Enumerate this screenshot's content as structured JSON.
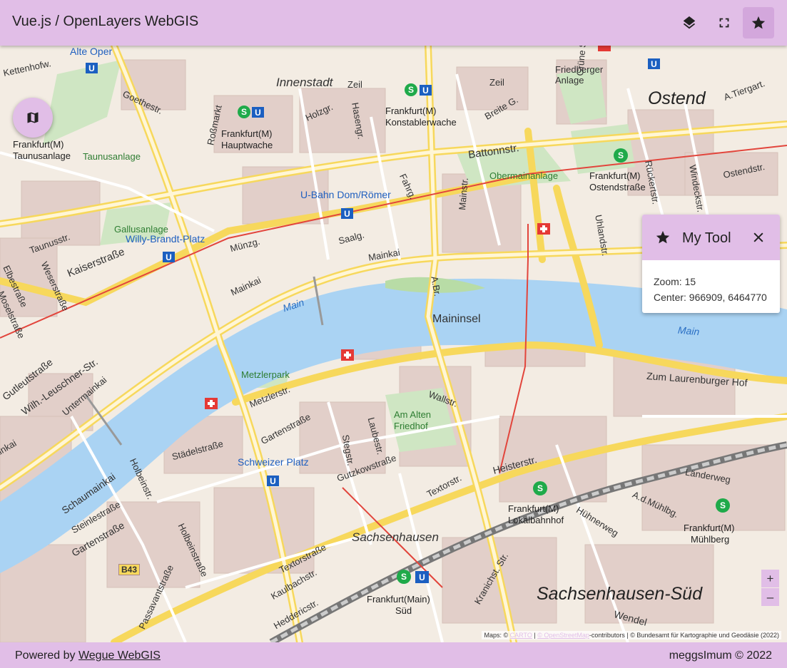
{
  "header": {
    "title": "Vue.js / OpenLayers WebGIS",
    "icons": [
      "layers-icon",
      "fullscreen-icon",
      "star-icon"
    ]
  },
  "map": {
    "labels": {
      "ostend": "Ostend",
      "innenstadt": "Innenstadt",
      "sachsenhausen": "Sachsenhausen",
      "sachsenhausen_sued": "Sachsenhausen-Süd",
      "alte_oper": "Alte Oper",
      "kettenhofw": "Kettenhofw.",
      "zeil": "Zeil",
      "zeil2": "Zeil",
      "friedberger": "Friedberger Anlage",
      "gruene_str": "Grüne Straße",
      "a_tiergart": "A.Tiergart.",
      "breite_g": "Breite G.",
      "holzgr": "Holzgr.",
      "hasengr": "Hasengr.",
      "rossmarkt": "Roßmarkt",
      "goethestr": "Goethestr.",
      "taunusanlage": "Taunusanlage",
      "frankfurt_m_taunus": "Frankfurt(M)",
      "taunus_station": "Taunusanlage",
      "hauptwache_a": "Frankfurt(M)",
      "hauptwache_b": "Hauptwache",
      "konst_a": "Frankfurt(M)",
      "konst_b": "Konstablerwache",
      "battonnstr": "Battonnstr.",
      "obermainanlage": "Obermainanlage",
      "ostendstr_a": "Frankfurt(M)",
      "ostendstr_b": "Ostendstraße",
      "rueckertstr": "Rückertstr.",
      "windeckstr": "Windeckstr.",
      "ostendstr": "Ostendstr.",
      "uhlandstr": "Uhlandstr.",
      "dom_roemer": "U-Bahn Dom/Römer",
      "fahrg": "Fahrg.",
      "gallusanlage": "Gallusanlage",
      "willy_brandt": "Willy-Brandt-Platz",
      "taunusstr": "Taunusstr.",
      "kaiserstr": "Kaiserstraße",
      "muenzg": "Münzg.",
      "saalg": "Saalg.",
      "mainkai": "Mainkai",
      "mainkai2": "Mainkai",
      "mainstr": "Mainstr.",
      "alte_br": "A.Br.",
      "maininsel": "Maininsel",
      "main1": "Main",
      "main2": "Main",
      "weserstr": "Weserstraße",
      "elbestr": "Elbestraße",
      "moselstr": "Moselstraße",
      "gutleutstr": "Gutleutstraße",
      "leuschner": "Wilh.-Leuschner-Str.",
      "untermainkai": "Untermainkai",
      "metzlerpark": "Metzlerpark",
      "metzlerstr": "Metzlerstr.",
      "gartenstr": "Gartenstraße",
      "wallstr": "Wallstr.",
      "zum_laurenburger": "Zum Laurenburger Hof",
      "staedelstr": "Städelstraße",
      "schweizer_platz": "Schweizer Platz",
      "stegstr": "Stegstr.",
      "laubestr": "Laubestr.",
      "am_alten_friedhof": "Am Alten Friedhof",
      "gutzkowstr": "Gutzkowstraße",
      "textorstr": "Textorstr.",
      "heisterstr": "Heisterstr.",
      "laenderweg": "Länderweg",
      "lokalbahnhof_a": "Frankfurt(M)",
      "lokalbahnhof_b": "Lokalbahnhof",
      "huehnerweg": "Hühnerweg",
      "a_d_muehlbg": "A.d.Mühlbg.",
      "muehlberg_a": "Frankfurt(M)",
      "muehlberg_b": "Mühlberg",
      "schaumainkai": "Schaumainkai",
      "holbeinstr": "Holbeinstr.",
      "holbeinstr2": "Holbeinstraße",
      "steinlestr": "Steinlestraße",
      "gartenstr2": "Gartenstraße",
      "b43": "B43",
      "passavantstr": "Passavantstraße",
      "textorstr2": "Textorstraße",
      "kaulbachstr": "Kaulbachstr.",
      "heddericstr": "Heddericstr.",
      "sued_a": "Frankfurt(Main)",
      "sued_b": "Süd",
      "kranichstr": "Kranichst. Str.",
      "wendel": "Wendel",
      "mainkai_left": "Mainkai"
    }
  },
  "fab": {
    "icon": "map-icon"
  },
  "tool": {
    "title": "My Tool",
    "zoom_text": "Zoom: 15",
    "center_text": "Center: 966909, 6464770"
  },
  "zoom": {
    "in": "+",
    "out": "–"
  },
  "attribution": {
    "prefix": "Maps: ©",
    "carto": "CARTO",
    "sep": "|",
    "osm": "© OpenStreetMap",
    "rest": "-contributors | © Bundesamt für Kartographie und Geodäsie (2022)"
  },
  "footer": {
    "powered_prefix": "Powered by",
    "powered_link": "Wegue WebGIS",
    "copyright": "meggsImum © 2022"
  }
}
